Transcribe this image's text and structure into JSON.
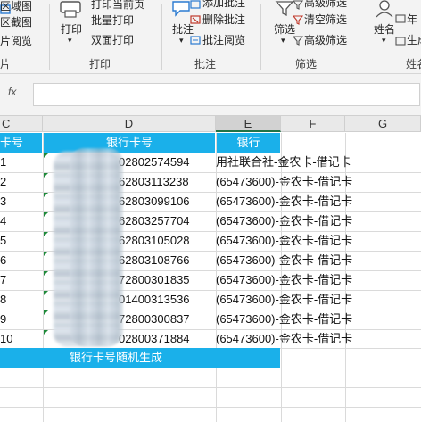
{
  "ribbon": {
    "left_group": {
      "items": [
        "区域图",
        "区截图",
        "片阅览"
      ],
      "group_label": "片"
    },
    "print_group": {
      "big_button": "打印",
      "items": [
        "打印当前页",
        "批量打印",
        "双面打印"
      ],
      "group_label": "打印"
    },
    "annotate_group": {
      "big_button": "批注",
      "items": [
        "添加批注",
        "删除批注",
        "批注阅览"
      ],
      "group_label": "批注"
    },
    "filter_group": {
      "big_button": "筛选",
      "items": [
        "高级筛选",
        "清空筛选",
        "高级筛选"
      ],
      "group_label": "筛选"
    },
    "name_group": {
      "big_button": "姓名",
      "items": [
        "年",
        "生成"
      ],
      "group_label": "姓名"
    }
  },
  "formula_bar": {
    "fx_label": "fx",
    "value": ""
  },
  "columns": [
    "C",
    "D",
    "E",
    "F",
    "G"
  ],
  "header_row": {
    "c": "卡号",
    "d": "银行卡号",
    "e": "银行"
  },
  "rows": [
    {
      "c": "1",
      "d": "02802574594",
      "e": "用社联合社-金农卡-借记卡"
    },
    {
      "c": "2",
      "d": "62803113238",
      "e": "(65473600)-金农卡-借记卡"
    },
    {
      "c": "3",
      "d": "62803099106",
      "e": "(65473600)-金农卡-借记卡"
    },
    {
      "c": "4",
      "d": "62803257704",
      "e": "(65473600)-金农卡-借记卡"
    },
    {
      "c": "5",
      "d": "62803105028",
      "e": "(65473600)-金农卡-借记卡"
    },
    {
      "c": "6",
      "d": "62803108766",
      "e": "(65473600)-金农卡-借记卡"
    },
    {
      "c": "7",
      "d": "72800301835",
      "e": "(65473600)-金农卡-借记卡"
    },
    {
      "c": "8",
      "d": "01400313536",
      "e": "(65473600)-金农卡-借记卡"
    },
    {
      "c": "9",
      "d": "72800300837",
      "e": "(65473600)-金农卡-借记卡"
    },
    {
      "c": "10",
      "d": "02800371884",
      "e": "(65473600)-金农卡-借记卡"
    }
  ],
  "footer_note": "银行卡号随机生成",
  "colors": {
    "header_fill": "#1ab0ea",
    "ribbon_bg": "#f3f3f3",
    "selected_col_underline": "#217346"
  }
}
